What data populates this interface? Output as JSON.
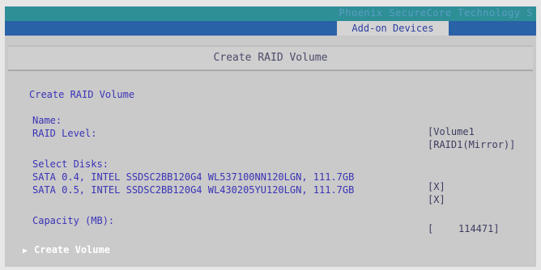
{
  "header": {
    "vendor": "Phoenix SecureCore Technology S",
    "active_tab": "Add-on Devices"
  },
  "form": {
    "title": "Create RAID Volume",
    "section_title": "Create RAID Volume",
    "name_label": "Name:",
    "name_value": "[Volume1",
    "raid_level_label": "RAID Level:",
    "raid_level_value": "[RAID1(Mirror)]",
    "select_disks_label": "Select Disks:",
    "disks": [
      {
        "label": "SATA 0.4, INTEL SSDSC2BB120G4 WL537100NN120LGN, 111.7GB",
        "checked": "[X]"
      },
      {
        "label": "SATA 0.5, INTEL SSDSC2BB120G4 WL430205YU120LGN, 111.7GB",
        "checked": "[X]"
      }
    ],
    "capacity_label": "Capacity (MB):",
    "capacity_open": "[",
    "capacity_value": "114471]",
    "create_volume": "Create Volume"
  }
}
